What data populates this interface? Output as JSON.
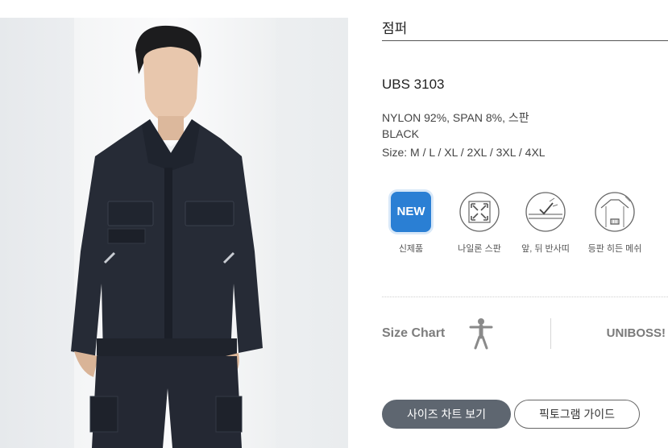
{
  "product": {
    "category": "점퍼",
    "model": "UBS 3103",
    "material": "NYLON 92%, SPAN 8%, 스판",
    "color": "BLACK",
    "sizes": "Size: M / L / XL / 2XL / 3XL / 4XL"
  },
  "features": [
    {
      "icon": "new-badge-icon",
      "badge": "NEW",
      "label": "신제품"
    },
    {
      "icon": "stretch-arrows-icon",
      "label": "나일론 스판"
    },
    {
      "icon": "reflective-check-icon",
      "label": "앞, 뒤 반사띠"
    },
    {
      "icon": "back-mesh-icon",
      "label": "등판 히든 메쉬"
    }
  ],
  "size_section": {
    "label": "Size Chart",
    "icon": "person-icon",
    "brand": "UNIBOSS!"
  },
  "buttons": {
    "size_chart": "사이즈 차트 보기",
    "pictogram": "픽토그램 가이드"
  },
  "colors": {
    "badge_blue": "#2a7fd4",
    "primary_button": "#5e6670",
    "jacket": "#262b36"
  }
}
